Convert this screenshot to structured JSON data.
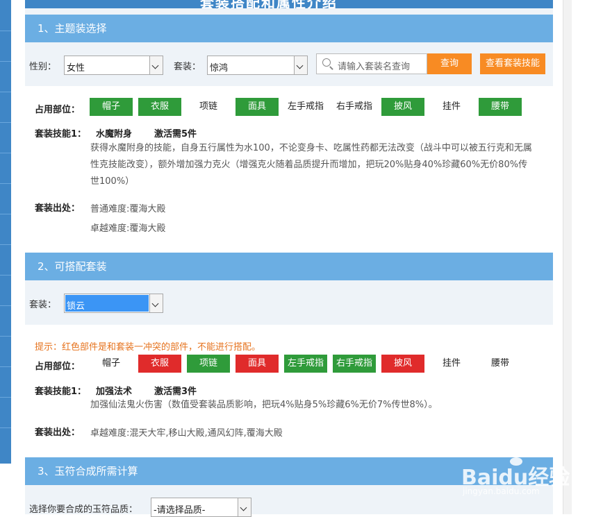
{
  "page": {
    "title": "套装搭配和属性介绍"
  },
  "section1": {
    "header": "1、主题装选择",
    "gender_label": "性别：",
    "gender_value": "女性",
    "set_label": "套装：",
    "set_value": "惊鸿",
    "search_placeholder": "请输入套装名查询",
    "search_button": "查询",
    "view_skill_button": "查看套装技能",
    "parts_label": "占用部位：",
    "parts": [
      {
        "name": "帽子",
        "state": "green"
      },
      {
        "name": "衣服",
        "state": "green"
      },
      {
        "name": "项链",
        "state": "plain"
      },
      {
        "name": "面具",
        "state": "green"
      },
      {
        "name": "左手戒指",
        "state": "plain"
      },
      {
        "name": "右手戒指",
        "state": "plain"
      },
      {
        "name": "披风",
        "state": "green"
      },
      {
        "name": "挂件",
        "state": "plain"
      },
      {
        "name": "腰带",
        "state": "green"
      }
    ],
    "skill_label": "套装技能1：",
    "skill_name": "水魔附身",
    "skill_activate": "激活需5件",
    "skill_desc": "获得水魔附身的技能，自身五行属性为水100，不论变身卡、吃属性药都无法改变（战斗中可以被五行克和无属性克技能改变），额外增加强力克火（增强克火随着品质提升而增加，把玩20%贴身40%珍藏60%无价80%传世100%）",
    "source_label": "套装出处：",
    "source_normal": "普通难度:覆海大殿",
    "source_hard": "卓越难度:覆海大殿"
  },
  "section2": {
    "header": "2、可搭配套装",
    "set_label": "套装：",
    "set_value": "锁云",
    "tip": "提示：红色部件是和套装一冲突的部件，不能进行搭配。",
    "parts_label": "占用部位：",
    "parts": [
      {
        "name": "帽子",
        "state": "plain"
      },
      {
        "name": "衣服",
        "state": "red"
      },
      {
        "name": "项链",
        "state": "green"
      },
      {
        "name": "面具",
        "state": "red"
      },
      {
        "name": "左手戒指",
        "state": "green"
      },
      {
        "name": "右手戒指",
        "state": "green"
      },
      {
        "name": "披风",
        "state": "red"
      },
      {
        "name": "挂件",
        "state": "plain"
      },
      {
        "name": "腰带",
        "state": "plain"
      }
    ],
    "skill_label": "套装技能1：",
    "skill_name": "加强法术",
    "skill_activate": "激活需3件",
    "skill_desc": "加强仙法鬼火伤害（数值受套装品质影响，把玩4%贴身5%珍藏6%无价7%传世8%）。",
    "source_label": "套装出处：",
    "source_hard": "卓越难度:混天大牢,移山大殿,通风幻阵,覆海大殿"
  },
  "section3": {
    "header": "3、玉符合成所需计算",
    "quality_label": "选择你要合成的玉符品质：",
    "quality_value": "-请选择品质-"
  },
  "watermark": {
    "brand": "Baidu经验",
    "url": "jingyan.baidu.com"
  },
  "colors": {
    "header_blue": "#6baee3",
    "accent_orange": "#f88b23",
    "part_green": "#2f9b3a",
    "part_red": "#e02b2b"
  }
}
